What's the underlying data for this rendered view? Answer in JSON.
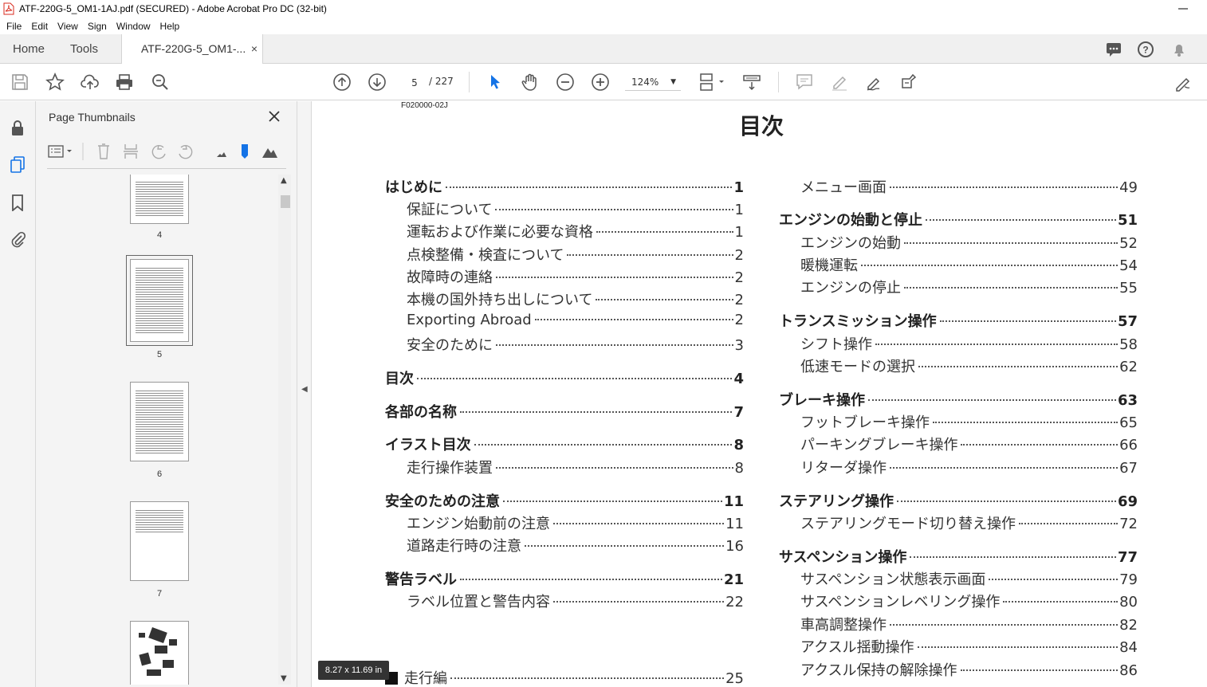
{
  "window": {
    "title": "ATF-220G-5_OM1-1AJ.pdf (SECURED) - Adobe Acrobat Pro DC (32-bit)"
  },
  "menu": [
    "File",
    "Edit",
    "View",
    "Sign",
    "Window",
    "Help"
  ],
  "tabs": {
    "home": "Home",
    "tools": "Tools",
    "document": "ATF-220G-5_OM1-...",
    "close": "×"
  },
  "toolbar": {
    "page_current": "5",
    "page_total": "/ 227",
    "zoom": "124%",
    "zoom_caret": "▼"
  },
  "thumbnails": {
    "panel_title": "Page Thumbnails",
    "pages": [
      "4",
      "5",
      "6",
      "7"
    ]
  },
  "document": {
    "id_code": "F020000-02J",
    "title": "目次",
    "left": [
      {
        "text": "はじめに",
        "page": "1",
        "level": "h"
      },
      {
        "text": "保証について",
        "page": "1",
        "level": "sub"
      },
      {
        "text": "運転および作業に必要な資格",
        "page": "1",
        "level": "sub"
      },
      {
        "text": "点検整備・検査について",
        "page": "2",
        "level": "sub"
      },
      {
        "text": "故障時の連絡",
        "page": "2",
        "level": "sub"
      },
      {
        "text": "本機の国外持ち出しについて",
        "page": "2",
        "level": "sub"
      },
      {
        "text": "Exporting Abroad",
        "page": "2",
        "level": "sub"
      },
      {
        "text": "安全のために",
        "page": "3",
        "level": "sub"
      },
      {
        "text": "目次",
        "page": "4",
        "level": "h"
      },
      {
        "text": "各部の名称",
        "page": "7",
        "level": "h"
      },
      {
        "text": "イラスト目次",
        "page": "8",
        "level": "h"
      },
      {
        "text": "走行操作装置",
        "page": "8",
        "level": "sub"
      },
      {
        "text": "安全のための注意",
        "page": "11",
        "level": "h"
      },
      {
        "text": "エンジン始動前の注意",
        "page": "11",
        "level": "sub"
      },
      {
        "text": "道路走行時の注意",
        "page": "16",
        "level": "sub"
      },
      {
        "text": "警告ラベル",
        "page": "21",
        "level": "h"
      },
      {
        "text": "ラベル位置と警告内容",
        "page": "22",
        "level": "sub"
      },
      {
        "text": "走行編",
        "page": "25",
        "level": "sec"
      }
    ],
    "right": [
      {
        "text": "メニュー画面",
        "page": "49",
        "level": "sub"
      },
      {
        "text": "エンジンの始動と停止",
        "page": "51",
        "level": "h"
      },
      {
        "text": "エンジンの始動",
        "page": "52",
        "level": "sub"
      },
      {
        "text": "暖機運転",
        "page": "54",
        "level": "sub"
      },
      {
        "text": "エンジンの停止",
        "page": "55",
        "level": "sub"
      },
      {
        "text": "トランスミッション操作",
        "page": "57",
        "level": "h"
      },
      {
        "text": "シフト操作",
        "page": "58",
        "level": "sub"
      },
      {
        "text": "低速モードの選択",
        "page": "62",
        "level": "sub"
      },
      {
        "text": "ブレーキ操作",
        "page": "63",
        "level": "h"
      },
      {
        "text": "フットブレーキ操作",
        "page": "65",
        "level": "sub"
      },
      {
        "text": "パーキングブレーキ操作",
        "page": "66",
        "level": "sub"
      },
      {
        "text": "リターダ操作",
        "page": "67",
        "level": "sub"
      },
      {
        "text": "ステアリング操作",
        "page": "69",
        "level": "h"
      },
      {
        "text": "ステアリングモード切り替え操作",
        "page": "72",
        "level": "sub"
      },
      {
        "text": "サスペンション操作",
        "page": "77",
        "level": "h"
      },
      {
        "text": "サスペンション状態表示画面",
        "page": "79",
        "level": "sub"
      },
      {
        "text": "サスペンションレベリング操作",
        "page": "80",
        "level": "sub"
      },
      {
        "text": "車高調整操作",
        "page": "82",
        "level": "sub"
      },
      {
        "text": "アクスル揺動操作",
        "page": "84",
        "level": "sub"
      },
      {
        "text": "アクスル保持の解除操作",
        "page": "86",
        "level": "sub"
      }
    ]
  },
  "status": {
    "page_size": "8.27 x 11.69 in"
  },
  "colors": {
    "accent": "#1473e6",
    "pdf_red": "#d9291c"
  }
}
